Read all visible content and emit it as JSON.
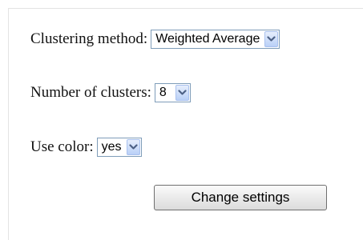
{
  "clustering": {
    "label": "Clustering method:",
    "selected": "Weighted Average"
  },
  "clusters": {
    "label": "Number of clusters:",
    "selected": "8"
  },
  "color": {
    "label": "Use color:",
    "selected": "yes"
  },
  "actions": {
    "change_settings": "Change settings"
  },
  "icons": {
    "dropdown": "chevron-down-icon"
  },
  "colors": {
    "select_border": "#7f9db9",
    "arrow_fill": "#b9d0f7",
    "arrow_glyph": "#4d6185"
  }
}
